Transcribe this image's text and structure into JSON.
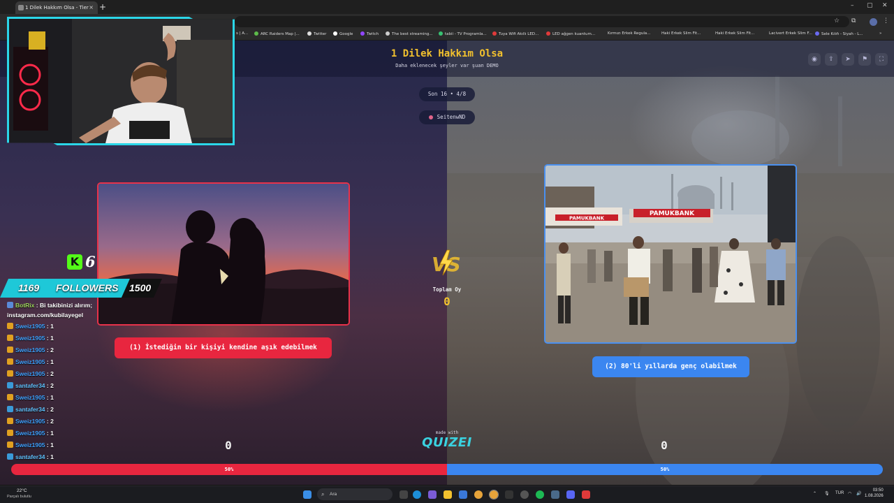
{
  "browser": {
    "tab_title": "1 Dilek Hakkım Olsa - Tier List...",
    "new_tab": "+",
    "close": "×",
    "minimize": "–",
    "maximize": "▢",
    "window_close": "✕",
    "bookmarks": [
      "s | A...",
      "ARC Raiders Map |...",
      "Twitter",
      "Google",
      "Twitch",
      "The best streaming...",
      "tabii - TV Programla...",
      "Tuya Wifi Akıllı LED...",
      "LED ağgen kuantum...",
      "Kırmızı Erkek Regula...",
      "Haki Erkek Slim Fit...",
      "Haki Erkek Slim Fit...",
      "Lacivert Erkek Slim F...",
      "Sele Kılıfı - Siyah - L..."
    ],
    "bookmark_more": "»"
  },
  "page": {
    "title": "1 Dilek Hakkım Olsa",
    "subtitle": "Daha eklenecek şeyler var şuan DEMO",
    "round_pill": "Son 16 • 4/8",
    "user_pill": "SeitenwND",
    "total_label": "Toplam Oy",
    "total_value": "0",
    "made_with": "made with",
    "brand": "QUIZEI",
    "vs_text": "VS"
  },
  "options": {
    "left": {
      "label": "(1) İstediğin bir kişiyi kendine aşık edebilmek",
      "score": "0",
      "percent_label": "50%",
      "share": 0.5,
      "color": "#e8263f"
    },
    "right": {
      "label": "(2) 80'li yıllarda genç olabilmek",
      "score": "0",
      "percent_label": "50%",
      "share": 0.5,
      "color": "#3b86f0"
    }
  },
  "photo_right": {
    "sign_1": "PAMUKBANK",
    "sign_2": "PAMUKBANK"
  },
  "overlay": {
    "kick_letter": "K",
    "kick_count": "6",
    "followers_current": "1169",
    "followers_label": "FOLLOWERS",
    "followers_goal": "1500"
  },
  "chat": [
    {
      "user": "BotRix",
      "sep": ":",
      "msg": "Bi takibinizi alırım; instagram.com/kubilayegel",
      "kind": "bot"
    },
    {
      "user": "Sweiz1905",
      "sep": ":",
      "msg": "1",
      "kind": "gold"
    },
    {
      "user": "Sweiz1905",
      "sep": ":",
      "msg": "1",
      "kind": "gold"
    },
    {
      "user": "Sweiz1905",
      "sep": ":",
      "msg": "2",
      "kind": "gold"
    },
    {
      "user": "Sweiz1905",
      "sep": ":",
      "msg": "1",
      "kind": "gold"
    },
    {
      "user": "Sweiz1905",
      "sep": ":",
      "msg": "2",
      "kind": "gold"
    },
    {
      "user": "santafer34",
      "sep": ":",
      "msg": "2",
      "kind": "teal"
    },
    {
      "user": "Sweiz1905",
      "sep": ":",
      "msg": "1",
      "kind": "gold"
    },
    {
      "user": "santafer34",
      "sep": ":",
      "msg": "2",
      "kind": "teal"
    },
    {
      "user": "Sweiz1905",
      "sep": ":",
      "msg": "2",
      "kind": "gold"
    },
    {
      "user": "Sweiz1905",
      "sep": ":",
      "msg": "1",
      "kind": "gold"
    },
    {
      "user": "Sweiz1905",
      "sep": ":",
      "msg": "1",
      "kind": "gold"
    },
    {
      "user": "santafer34",
      "sep": ":",
      "msg": "1",
      "kind": "teal"
    }
  ],
  "taskbar": {
    "temp": "22°C",
    "weather": "Parçalı bulutlu",
    "search": "Ara",
    "lang": "TUR",
    "time": "03:50",
    "date": "1.08.2026"
  },
  "colors": {
    "title": "#f2c12e",
    "red": "#e8263f",
    "blue": "#3b86f0",
    "overlay_accent": "#2bd6e8",
    "kick_green": "#53fc18"
  }
}
